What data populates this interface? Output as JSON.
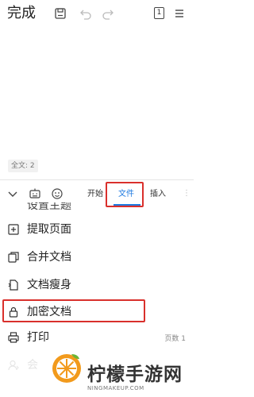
{
  "header": {
    "done_label": "完成",
    "page_indicator": "1"
  },
  "document": {
    "word_count": "全文: 2"
  },
  "toolbar": {
    "tabs": [
      {
        "label": "开始"
      },
      {
        "label": "文件"
      },
      {
        "label": "插入"
      }
    ],
    "active_tab": "文件"
  },
  "menu": {
    "partial_label": "设置主题",
    "items": [
      {
        "label": "提取页面",
        "icon": "extract-page-icon"
      },
      {
        "label": "合并文档",
        "icon": "merge-doc-icon"
      },
      {
        "label": "文档瘦身",
        "icon": "slim-doc-icon"
      },
      {
        "label": "加密文档",
        "icon": "lock-icon"
      },
      {
        "label": "打印",
        "icon": "print-icon",
        "extra": "页数 1"
      },
      {
        "label": "会",
        "icon": "user-icon"
      }
    ]
  },
  "watermark": {
    "name": "柠檬手游网",
    "url": "NINGMAKEUP.COM"
  },
  "colors": {
    "accent": "#1f7ae0",
    "highlight": "#d9302c",
    "watermark_orange": "#f29a1c",
    "watermark_green": "#6bb536"
  }
}
